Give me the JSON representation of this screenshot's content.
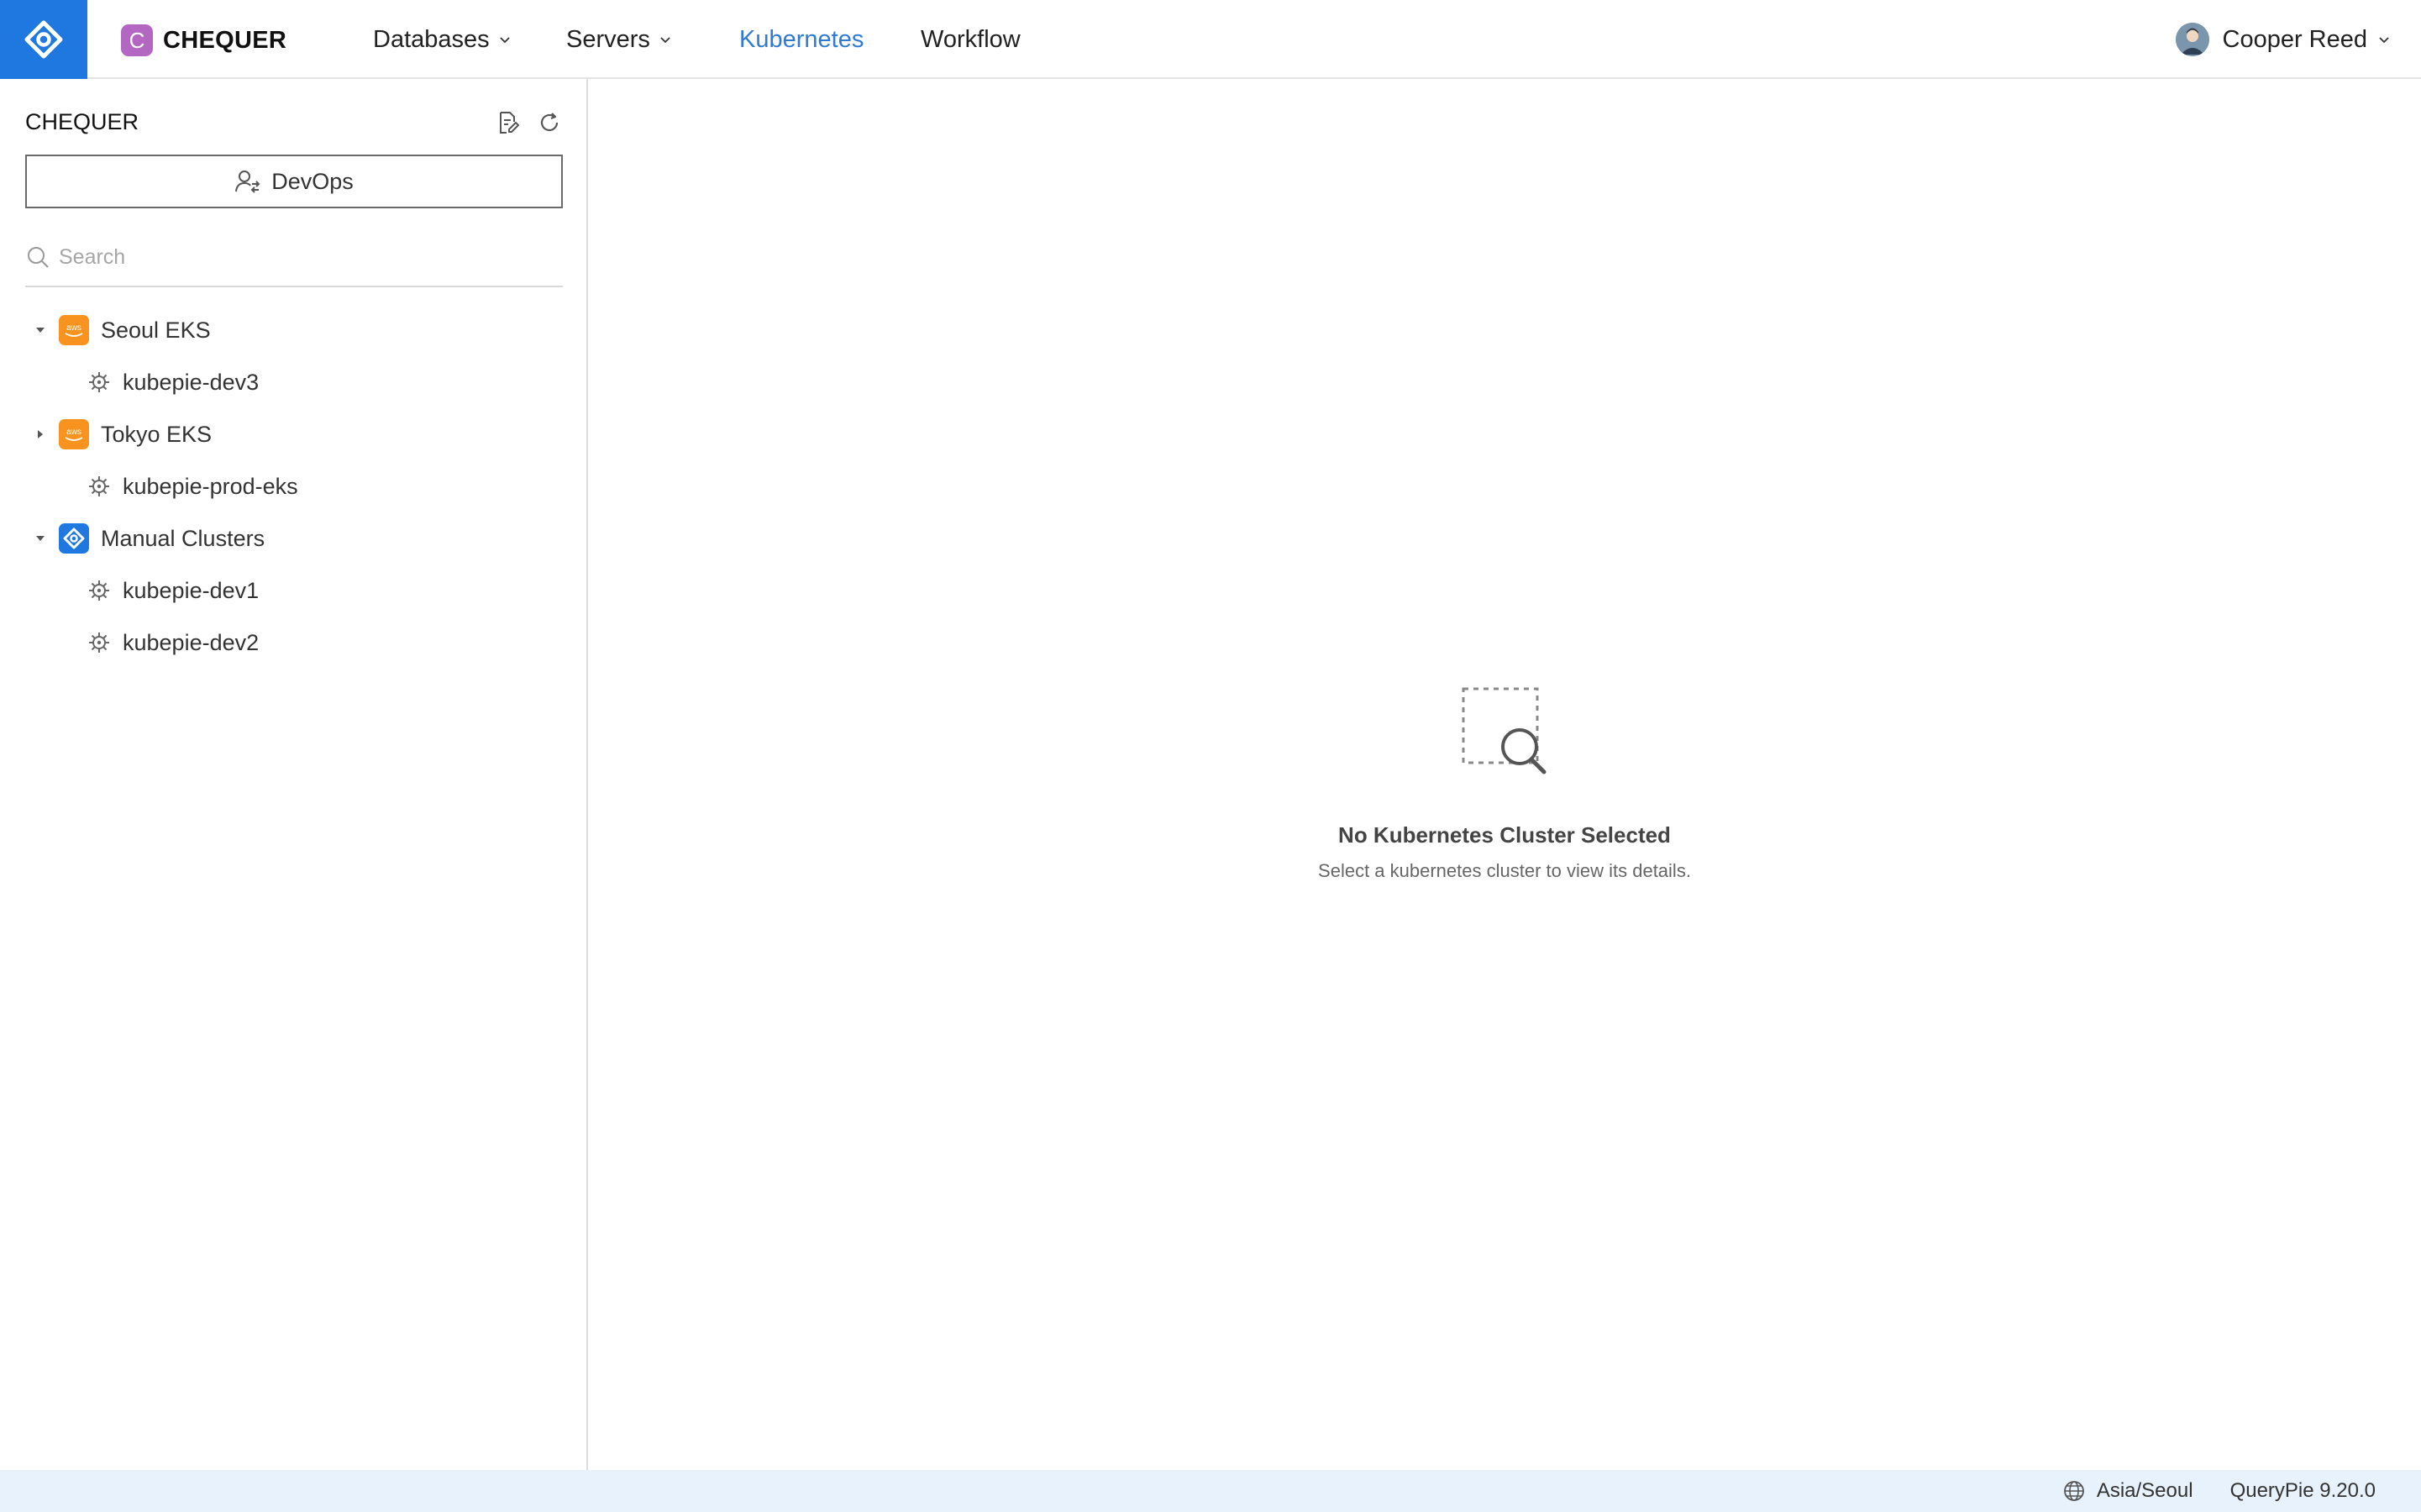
{
  "header": {
    "brand_initial": "C",
    "brand_name": "CHEQUER",
    "nav": [
      {
        "label": "Databases",
        "has_dropdown": true
      },
      {
        "label": "Servers",
        "has_dropdown": true
      },
      {
        "label": "Kubernetes",
        "active": true
      },
      {
        "label": "Workflow"
      }
    ],
    "user_name": "Cooper Reed"
  },
  "sidebar": {
    "title": "CHEQUER",
    "role_label": "DevOps",
    "search_placeholder": "Search",
    "tree": [
      {
        "label": "Seoul EKS",
        "expanded": true,
        "icon": "aws-icon",
        "children": [
          "kubepie-dev3"
        ]
      },
      {
        "label": "Tokyo EKS",
        "expanded": false,
        "icon": "aws-icon",
        "children": [
          "kubepie-prod-eks"
        ]
      },
      {
        "label": "Manual Clusters",
        "expanded": true,
        "icon": "querypie-icon",
        "children": [
          "kubepie-dev1",
          "kubepie-dev2"
        ]
      }
    ]
  },
  "main": {
    "empty_title": "No Kubernetes Cluster Selected",
    "empty_desc": "Select a kubernetes cluster to view its details."
  },
  "footer": {
    "timezone": "Asia/Seoul",
    "version": "QueryPie 9.20.0"
  },
  "colors": {
    "primary": "#1f78e0",
    "nav_active": "#2f7ad3",
    "brand_badge": "#b366c2",
    "aws_orange": "#f7931e",
    "footer_bg": "#e8f2fc"
  }
}
